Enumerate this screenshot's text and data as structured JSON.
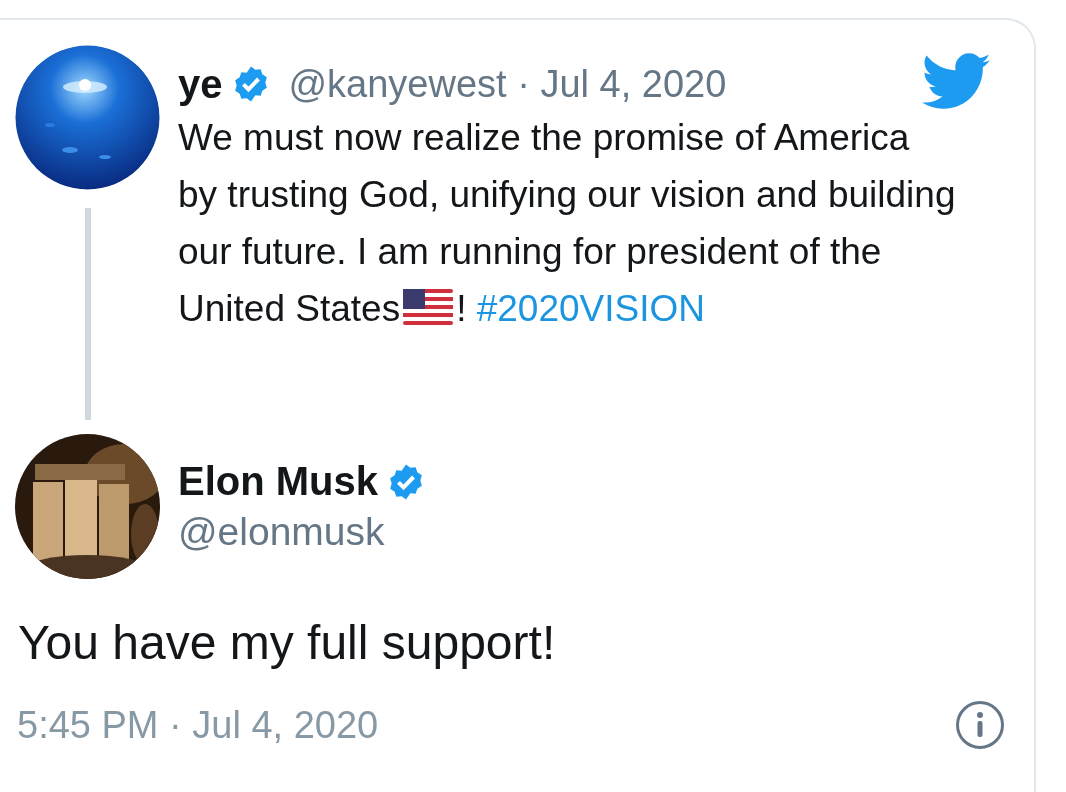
{
  "quoted_tweet": {
    "name": "ye",
    "verified": true,
    "handle": "@kanyewest",
    "separator": "·",
    "date": "Jul 4, 2020",
    "text_before": "We must now realize the promise of America by trusting God, unifying our vision and building our future. I am running for president of the United States",
    "text_after": "!",
    "hashtag": "#2020VISION"
  },
  "tweet": {
    "name": "Elon Musk",
    "verified": true,
    "handle": "@elonmusk",
    "text": "You have my full support!",
    "timestamp": "5:45 PM · Jul 4, 2020"
  }
}
